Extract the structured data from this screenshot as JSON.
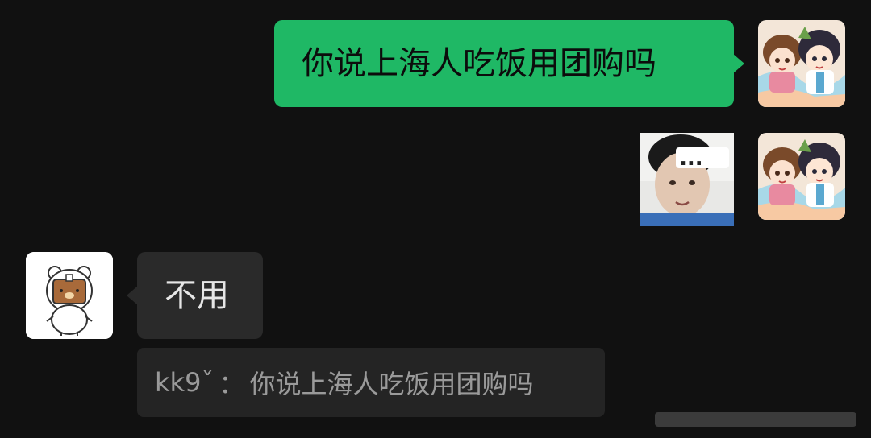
{
  "messages": [
    {
      "side": "right",
      "type": "text",
      "text": "你说上海人吃饭用团购吗",
      "avatar_icon": "anime-couple-avatar"
    },
    {
      "side": "right",
      "type": "sticker",
      "sticker_icon": "face-with-ellipsis-sticker",
      "sticker_text": "...",
      "avatar_icon": "anime-couple-avatar"
    },
    {
      "side": "left",
      "type": "text",
      "text": "不用",
      "avatar_icon": "rilakkuma-bear-avatar",
      "quote": {
        "author": "kk9ˇ",
        "separator": "：",
        "text": "你说上海人吃饭用团购吗"
      }
    }
  ],
  "colors": {
    "background": "#111111",
    "sent_bubble": "#1fb865",
    "received_bubble": "#2a2a2a",
    "quote_background": "#242424",
    "quote_text": "#9a9a9a"
  }
}
